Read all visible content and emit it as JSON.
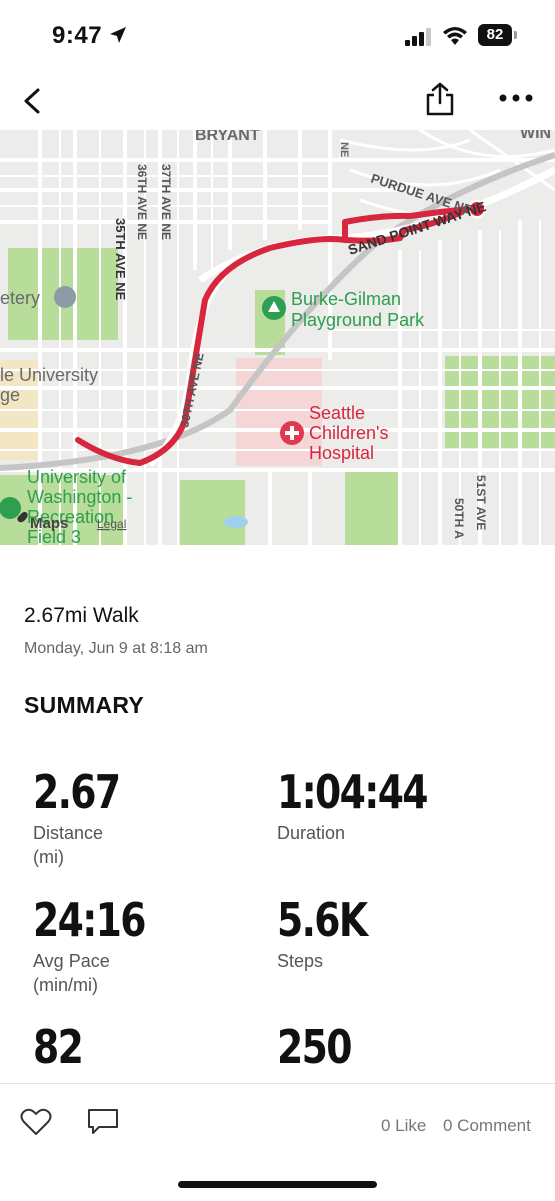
{
  "status_bar": {
    "time": "9:47",
    "battery": "82"
  },
  "map": {
    "labels": {
      "bryant": "BRYANT",
      "win": "WIN",
      "ne": "NE",
      "purdue": "PURDUE AVE NE",
      "sand_point": "SAND POINT WAY NE",
      "ave35": "35TH AVE NE",
      "ave36": "36TH AVE NE",
      "ave37": "37TH AVE NE",
      "ave39": "39TH AVE NE",
      "ave50": "50TH A",
      "ave51": "51ST AVE",
      "cemetery": "etery",
      "park_line1": "Burke-Gilman",
      "park_line2": "Playground Park",
      "univ_line1": "le University",
      "univ_line2": "ge",
      "hospital_line1": "Seattle",
      "hospital_line2": "Children's",
      "hospital_line3": "Hospital",
      "uw_line1": "University of",
      "uw_line2": "Washington -",
      "uw_line3": "Recreation",
      "uw_line4": "Field 3",
      "maps_brand": "Maps",
      "legal": "Legal"
    }
  },
  "activity": {
    "title": "2.67mi Walk",
    "datetime": "Monday, Jun 9 at 8:18 am"
  },
  "summary": {
    "heading": "SUMMARY",
    "stats": [
      {
        "value": "2.67",
        "label": "Distance",
        "unit": "(mi)"
      },
      {
        "value": "1:04:44",
        "label": "Duration",
        "unit": ""
      },
      {
        "value": "24:16",
        "label": "Avg Pace",
        "unit": "(min/mi)"
      },
      {
        "value": "5.6K",
        "label": "Steps",
        "unit": ""
      },
      {
        "value": "82",
        "label": "",
        "unit": ""
      },
      {
        "value": "250",
        "label": "",
        "unit": ""
      }
    ]
  },
  "social": {
    "likes": "0 Like",
    "comments": "0 Comment"
  },
  "colors": {
    "route": "#d7263d",
    "park": "#b8dc9a",
    "hospital": "#f5d6d6",
    "accent": "#2e9e50"
  }
}
